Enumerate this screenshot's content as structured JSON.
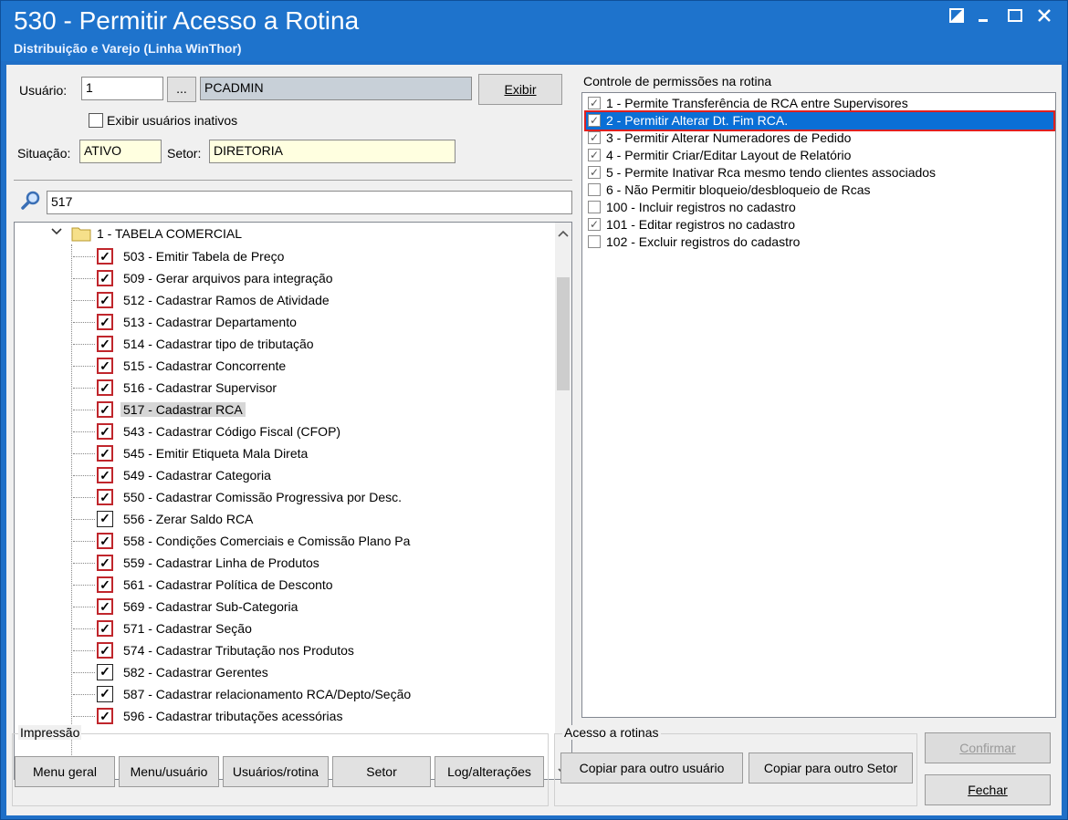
{
  "window": {
    "title": "530 - Permitir Acesso a Rotina",
    "subtitle": "Distribuição e Varejo (Linha WinThor)",
    "controls": [
      "restore-icon",
      "minimize-icon",
      "maximize-icon",
      "close-icon"
    ]
  },
  "user": {
    "label": "Usuário:",
    "code": "1",
    "browse": "...",
    "name": "PCADMIN",
    "show_button": "Exibir",
    "show_inactive": "Exibir usuários inativos",
    "status_label": "Situação:",
    "status": "ATIVO",
    "sector_label": "Setor:",
    "sector": "DIRETORIA"
  },
  "search": {
    "value": "517"
  },
  "tree": {
    "folder": "1 - TABELA COMERCIAL",
    "items": [
      {
        "label": "503 - Emitir Tabela de Preço",
        "style": "red"
      },
      {
        "label": "509 - Gerar arquivos para integração",
        "style": "red"
      },
      {
        "label": "512 - Cadastrar Ramos de Atividade",
        "style": "red"
      },
      {
        "label": "513 - Cadastrar Departamento",
        "style": "red"
      },
      {
        "label": "514 - Cadastrar tipo de tributação",
        "style": "red"
      },
      {
        "label": "515 - Cadastrar Concorrente",
        "style": "red"
      },
      {
        "label": "516 - Cadastrar Supervisor",
        "style": "red"
      },
      {
        "label": "517 - Cadastrar RCA",
        "style": "red",
        "selected": true
      },
      {
        "label": "543 - Cadastrar Código Fiscal (CFOP)",
        "style": "red"
      },
      {
        "label": "545 - Emitir Etiqueta Mala Direta",
        "style": "red"
      },
      {
        "label": "549 - Cadastrar Categoria",
        "style": "red"
      },
      {
        "label": "550 - Cadastrar Comissão Progressiva por Desc.",
        "style": "red"
      },
      {
        "label": "556 - Zerar Saldo RCA",
        "style": "plain"
      },
      {
        "label": "558 - Condições Comerciais e Comissão Plano Pa",
        "style": "red"
      },
      {
        "label": "559 - Cadastrar Linha de Produtos",
        "style": "red"
      },
      {
        "label": "561 - Cadastrar Política de Desconto",
        "style": "red"
      },
      {
        "label": "569 - Cadastrar Sub-Categoria",
        "style": "red"
      },
      {
        "label": "571 - Cadastrar Seção",
        "style": "red"
      },
      {
        "label": "574 - Cadastrar Tributação nos Produtos",
        "style": "red"
      },
      {
        "label": "582 - Cadastrar Gerentes",
        "style": "plain"
      },
      {
        "label": "587 - Cadastrar relacionamento RCA/Depto/Seção",
        "style": "plain"
      },
      {
        "label": "596 - Cadastrar tributações acessórias",
        "style": "red"
      }
    ]
  },
  "permissions": {
    "title": "Controle de permissões na rotina",
    "items": [
      {
        "label": "1 - Permite Transferência de RCA entre Supervisores",
        "checked": true
      },
      {
        "label": "2 - Permitir Alterar Dt. Fim RCA.",
        "checked": true,
        "selected": true
      },
      {
        "label": "3 - Permitir Alterar Numeradores de Pedido",
        "checked": true
      },
      {
        "label": "4 - Permitir Criar/Editar Layout de Relatório",
        "checked": true
      },
      {
        "label": "5 - Permite Inativar Rca mesmo tendo clientes associados",
        "checked": true
      },
      {
        "label": "6 - Não Permitir bloqueio/desbloqueio de Rcas",
        "checked": false
      },
      {
        "label": "100 - Incluir registros no cadastro",
        "checked": false
      },
      {
        "label": "101 - Editar registros no cadastro",
        "checked": true
      },
      {
        "label": "102 - Excluir registros do cadastro",
        "checked": false
      }
    ]
  },
  "print_group": {
    "title": "Impressão",
    "buttons": [
      "Menu geral",
      "Menu/usuário",
      "Usuários/rotina",
      "Setor",
      "Log/alterações"
    ]
  },
  "access_group": {
    "title": "Acesso a rotinas",
    "buttons": [
      "Copiar para outro usuário",
      "Copiar para outro Setor"
    ]
  },
  "actions": {
    "confirm": "Confirmar",
    "close": "Fechar"
  }
}
